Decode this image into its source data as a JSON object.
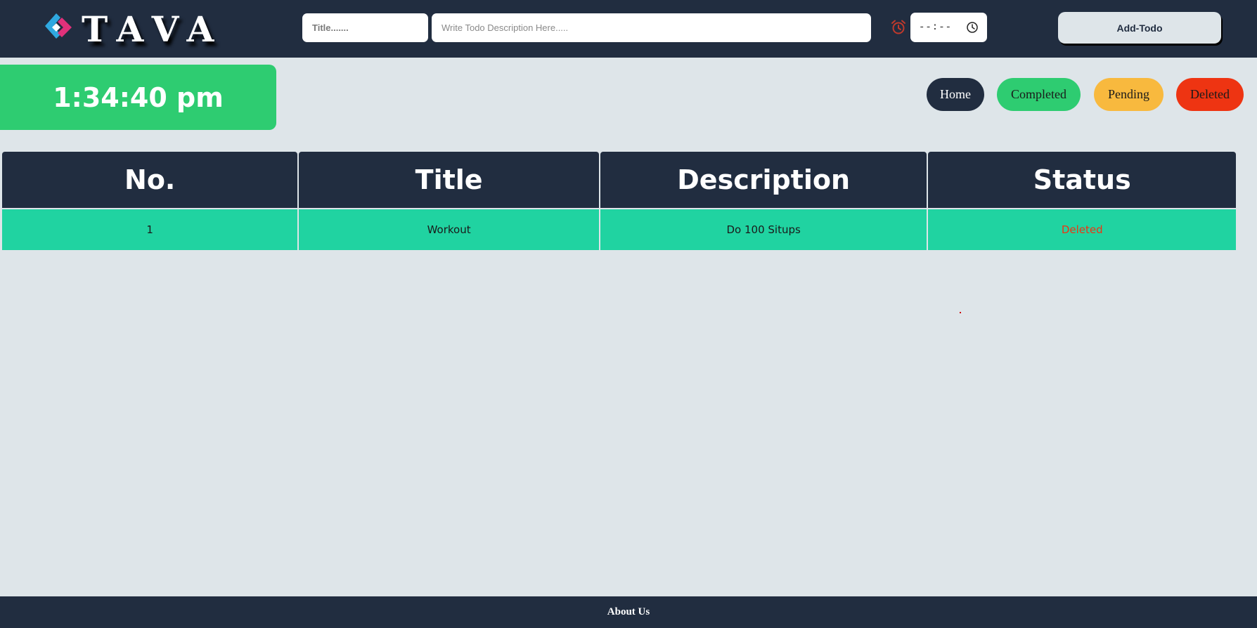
{
  "header": {
    "logo_text": "TAVA",
    "title_placeholder": "Title.......",
    "description_placeholder": "Write Todo Description Here.....",
    "time_value": "--:--",
    "add_button_label": "Add-Todo"
  },
  "clock": {
    "time": "1:34:40 pm"
  },
  "filters": {
    "home": "Home",
    "completed": "Completed",
    "pending": "Pending",
    "deleted": "Deleted"
  },
  "table": {
    "headers": [
      "No.",
      "Title",
      "Description",
      "Status"
    ],
    "rows": [
      {
        "no": "1",
        "title": "Workout",
        "description": "Do 100 Situps",
        "status": "Deleted"
      }
    ]
  },
  "footer": {
    "about_label": "About Us"
  },
  "colors": {
    "nav_background": "#212d40",
    "page_background": "#dee5e9",
    "completed_green": "#2ecc71",
    "pending_orange": "#f8b93e",
    "deleted_red": "#ee3412",
    "row_teal": "#20d3a1"
  },
  "icons": [
    "logo-mark-icon",
    "alarm-clock-icon",
    "clock-icon"
  ]
}
